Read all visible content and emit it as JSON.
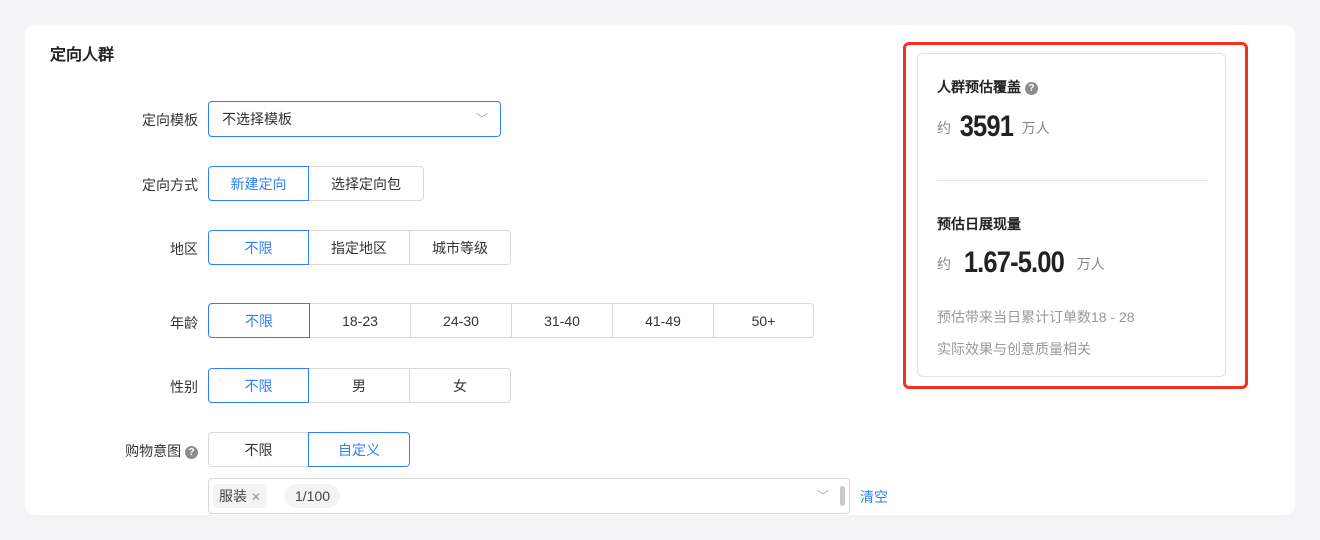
{
  "section_title": "定向人群",
  "template": {
    "label": "定向模板",
    "value": "不选择模板"
  },
  "method": {
    "label": "定向方式",
    "options": [
      "新建定向",
      "选择定向包"
    ],
    "selected": 0
  },
  "region": {
    "label": "地区",
    "options": [
      "不限",
      "指定地区",
      "城市等级"
    ],
    "selected": 0
  },
  "age": {
    "label": "年龄",
    "options": [
      "不限",
      "18-23",
      "24-30",
      "31-40",
      "41-49",
      "50+"
    ],
    "selected": 0
  },
  "gender": {
    "label": "性别",
    "options": [
      "不限",
      "男",
      "女"
    ],
    "selected": 0
  },
  "shopping": {
    "label": "购物意图",
    "help": "?",
    "options": [
      "不限",
      "自定义"
    ],
    "selected": 1,
    "tags": [
      "服装"
    ],
    "count": "1/100",
    "clear": "清空"
  },
  "estimate": {
    "coverage_title": "人群预估覆盖",
    "help": "?",
    "approx": "约",
    "coverage_value": "3591",
    "unit": "万人",
    "daily_title": "预估日展现量",
    "daily_value": "1.67-5.00",
    "orders_note": "预估带来当日累计订单数18 - 28",
    "quality_note": "实际效果与创意质量相关"
  }
}
